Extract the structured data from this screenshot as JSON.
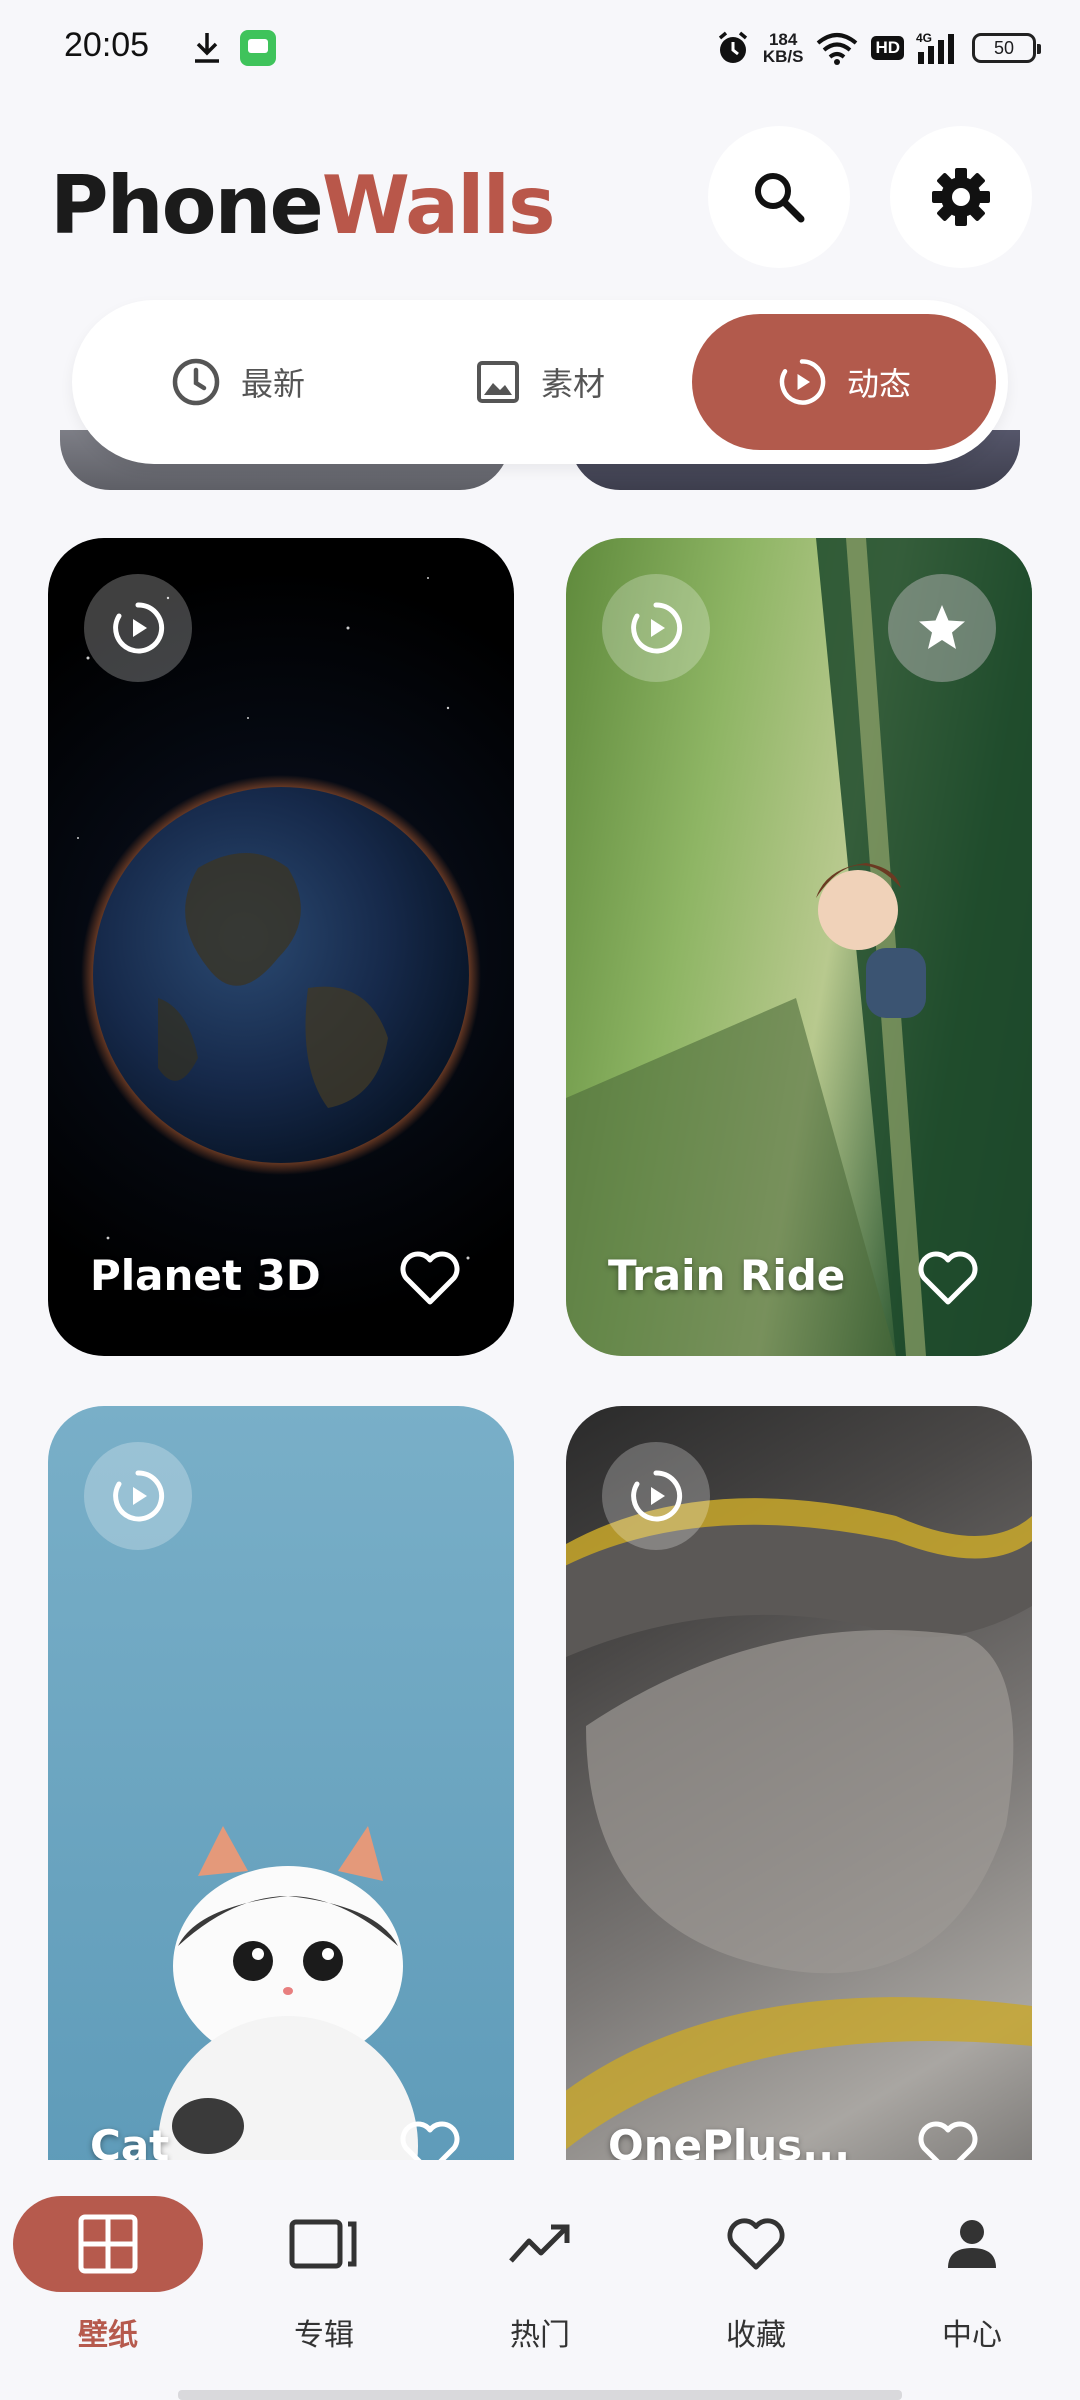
{
  "status_bar": {
    "time": "20:05",
    "net_speed_value": "184",
    "net_speed_unit": "KB/S",
    "hd": "HD",
    "network": "4G",
    "battery": "50"
  },
  "header": {
    "brand_part1": "Phone",
    "brand_part2": "Walls",
    "brand_accent": "#b9574a"
  },
  "tabs": [
    {
      "label": "最新",
      "icon": "clock-icon",
      "active": false
    },
    {
      "label": "素材",
      "icon": "image-icon",
      "active": false
    },
    {
      "label": "动态",
      "icon": "live-play-icon",
      "active": true
    }
  ],
  "cards": [
    {
      "title": "Planet 3D",
      "badge": "live-play-icon",
      "favorited": false
    },
    {
      "title": "Train Ride",
      "badge": "live-play-icon",
      "featured": true,
      "favorited": false
    },
    {
      "title": "Cat",
      "badge": "live-play-icon",
      "favorited": false
    },
    {
      "title": "OnePlus...",
      "badge": "live-play-icon",
      "favorited": false
    }
  ],
  "bottom_nav": [
    {
      "label": "壁纸",
      "icon": "grid-icon",
      "active": true
    },
    {
      "label": "专辑",
      "icon": "album-icon",
      "active": false
    },
    {
      "label": "热门",
      "icon": "trending-icon",
      "active": false
    },
    {
      "label": "收藏",
      "icon": "heart-icon",
      "active": false
    },
    {
      "label": "中心",
      "icon": "person-icon",
      "active": false
    }
  ],
  "colors": {
    "accent": "#b25a4c",
    "background": "#f7f7fa"
  }
}
